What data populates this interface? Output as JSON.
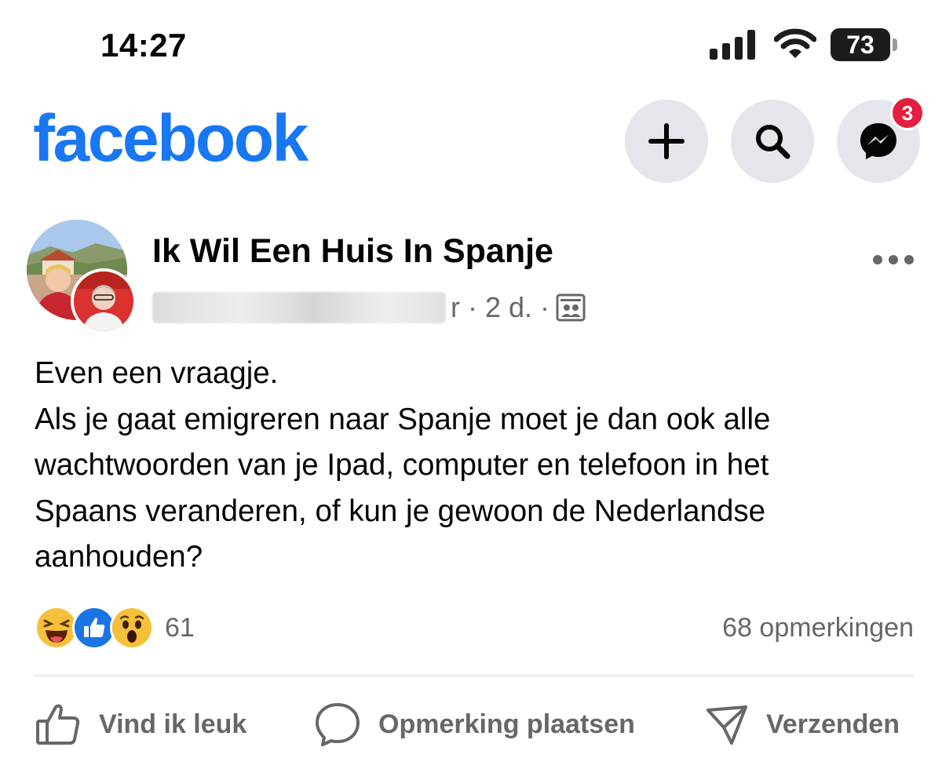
{
  "status_bar": {
    "time": "14:27",
    "battery_level": "73",
    "icons": [
      "signal-icon",
      "wifi-icon",
      "battery-icon"
    ]
  },
  "header": {
    "logo": "facebook",
    "accent_color": "#1877f2",
    "buttons": [
      "plus-icon",
      "search-icon",
      "messenger-icon"
    ],
    "messenger_badge": "3",
    "badge_color": "#e41e3f"
  },
  "post": {
    "group_name": "Ik Wil Een Huis In Spanje",
    "author_tail": "r · 2 d. ·",
    "text_lines": [
      "Even een vraagje.",
      "Als je gaat emigreren naar Spanje moet je dan ook alle",
      "wachtwoorden van je Ipad, computer en telefoon in het",
      "Spaans veranderen, of kun je gewoon de Nederlandse",
      "aanhouden?"
    ],
    "reaction_icons": [
      "haha-icon",
      "like-icon",
      "wow-icon"
    ],
    "reaction_count": "61",
    "comment_count": "68 opmerkingen"
  },
  "actions": {
    "like": "Vind ik leuk",
    "comment": "Opmerking plaatsen",
    "share": "Verzenden"
  }
}
